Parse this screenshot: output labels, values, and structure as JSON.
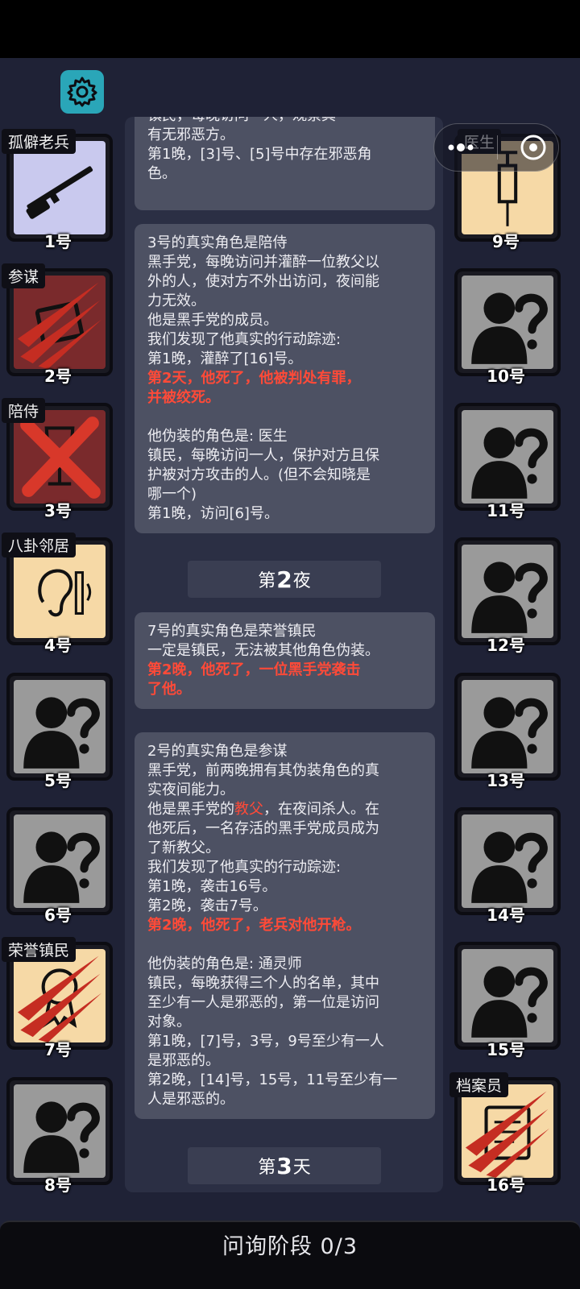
{
  "colors": {
    "background": "#1f2236",
    "card_unknown": "#9a9a9a",
    "card_dead": "#7a2a2c",
    "alert_red": "#ff4a38",
    "settings_teal": "#2aa6b8"
  },
  "toolbar": {
    "settings_icon": "gear-icon",
    "more_icon": "more-dots-icon",
    "close_icon": "target-icon"
  },
  "seats": {
    "1": {
      "number": "1号",
      "role": "孤僻老兵",
      "icon": "rifle-icon"
    },
    "2": {
      "number": "2号",
      "role": "参谋",
      "icon": "clipboard-icon",
      "status": "slashed"
    },
    "3": {
      "number": "3号",
      "role": "陪侍",
      "icon": "wine-glass-icon",
      "status": "executed"
    },
    "4": {
      "number": "4号",
      "role": "八卦邻居",
      "icon": "ear-icon"
    },
    "5": {
      "number": "5号",
      "icon": "unknown-person-icon"
    },
    "6": {
      "number": "6号",
      "icon": "unknown-person-icon"
    },
    "7": {
      "number": "7号",
      "role": "荣誉镇民",
      "icon": "medal-icon",
      "status": "slashed"
    },
    "8": {
      "number": "8号",
      "icon": "unknown-person-icon"
    },
    "9": {
      "number": "9号",
      "role": "医生",
      "icon": "syringe-icon"
    },
    "10": {
      "number": "10号",
      "icon": "unknown-person-icon"
    },
    "11": {
      "number": "11号",
      "icon": "unknown-person-icon"
    },
    "12": {
      "number": "12号",
      "icon": "unknown-person-icon"
    },
    "13": {
      "number": "13号",
      "icon": "unknown-person-icon"
    },
    "14": {
      "number": "14号",
      "icon": "unknown-person-icon"
    },
    "15": {
      "number": "15号",
      "icon": "unknown-person-icon"
    },
    "16": {
      "number": "16号",
      "role": "档案员",
      "icon": "document-icon",
      "status": "slashed"
    }
  },
  "log": {
    "card0": {
      "l1": "镇民，每晚访问一人，观察其",
      "l2": "有无邪恶方。",
      "l3": "第1晚，[3]号、[5]号中存在邪恶角",
      "l4": "色。"
    },
    "card1": {
      "l1": "3号的真实角色是陪侍",
      "l2": "黑手党，每晚访问并灌醉一位教父以",
      "l3": "外的人，使对方不外出访问，夜间能",
      "l4": "力无效。",
      "l5": "他是黑手党的成员。",
      "l6": "我们发现了他真实的行动踪迹:",
      "l7": "第1晚，灌醉了[16]号。",
      "l8": "第2天，他死了，他被判处有罪，",
      "l9": "并被绞死。",
      "l10": "他伪装的角色是: 医生",
      "l11": "镇民，每晚访问一人，保护对方且保",
      "l12": "护被对方攻击的人。(但不会知晓是",
      "l13": "哪一个)",
      "l14": "第1晚，访问[6]号。"
    },
    "divider1": {
      "pre": "第",
      "num": "2",
      "post": "夜"
    },
    "card2": {
      "l1": "7号的真实角色是荣誉镇民",
      "l2": "一定是镇民，无法被其他角色伪装。",
      "l3": "第2晚，他死了，一位黑手党袭击",
      "l4": "了他。"
    },
    "card3": {
      "l1": "2号的真实角色是参谋",
      "l2": "黑手党，前两晚拥有其伪装角色的真",
      "l3": "实夜间能力。",
      "l4a": "他是黑手党的",
      "l4b": "教父",
      "l4c": "，在夜间杀人。在",
      "l5": "他死后，一名存活的黑手党成员成为",
      "l6": "了新教父。",
      "l7": "我们发现了他真实的行动踪迹:",
      "l8": "第1晚，袭击16号。",
      "l9": "第2晚，袭击7号。",
      "l10": "第2晚，他死了，老兵对他开枪。",
      "l11": "他伪装的角色是: 通灵师",
      "l12": "镇民，每晚获得三个人的名单，其中",
      "l13": "至少有一人是邪恶的，第一位是访问",
      "l14": "对象。",
      "l15": "第1晚，[7]号，3号，9号至少有一人",
      "l16": "是邪恶的。",
      "l17": "第2晚，[14]号，15号，11号至少有一",
      "l18": "人是邪恶的。"
    },
    "divider2": {
      "pre": "第",
      "num": "3",
      "post": "天"
    }
  },
  "footer": {
    "phase_label": "问询阶段 0/3"
  }
}
